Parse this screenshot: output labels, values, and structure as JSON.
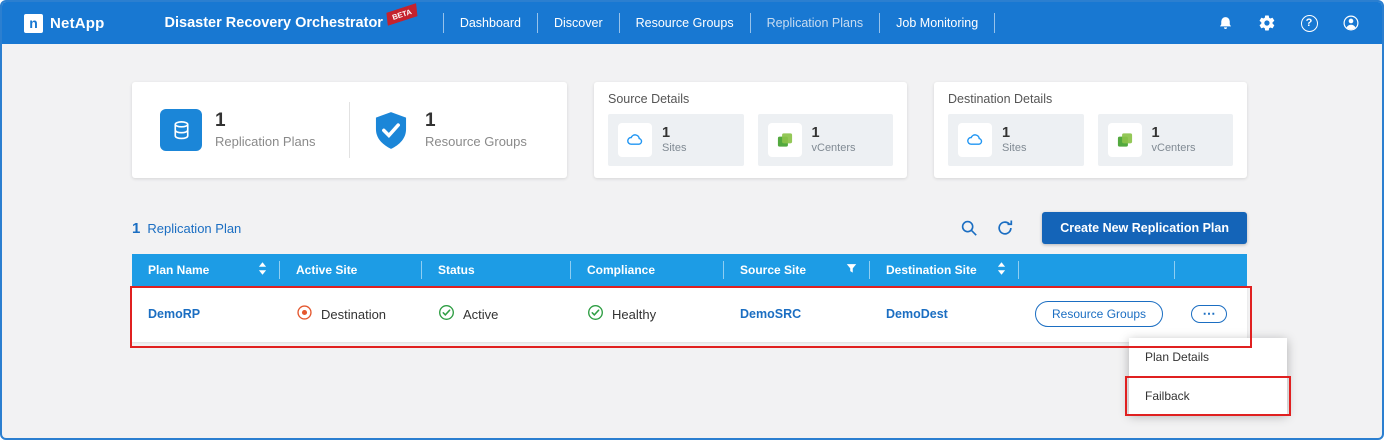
{
  "navbar": {
    "brand": "NetApp",
    "title": "Disaster Recovery Orchestrator",
    "beta": "BETA",
    "items": [
      {
        "label": "Dashboard"
      },
      {
        "label": "Discover"
      },
      {
        "label": "Resource Groups"
      },
      {
        "label": "Replication Plans"
      },
      {
        "label": "Job Monitoring"
      }
    ]
  },
  "icons": {
    "logo_letter": "n",
    "help_glyph": "?",
    "more_glyph": "⋯"
  },
  "summary": {
    "replication_plans": {
      "count": "1",
      "label": "Replication Plans"
    },
    "resource_groups": {
      "count": "1",
      "label": "Resource Groups"
    }
  },
  "source_details": {
    "title": "Source Details",
    "sites": {
      "count": "1",
      "label": "Sites"
    },
    "vcenters": {
      "count": "1",
      "label": "vCenters"
    }
  },
  "destination_details": {
    "title": "Destination Details",
    "sites": {
      "count": "1",
      "label": "Sites"
    },
    "vcenters": {
      "count": "1",
      "label": "vCenters"
    }
  },
  "plans_section": {
    "count": "1",
    "label": "Replication Plan",
    "create_button": "Create New Replication Plan"
  },
  "table": {
    "headers": [
      "Plan Name",
      "Active Site",
      "Status",
      "Compliance",
      "Source Site",
      "Destination Site"
    ],
    "row": {
      "plan_name": "DemoRP",
      "active_site": "Destination",
      "status": "Active",
      "compliance": "Healthy",
      "source_site": "DemoSRC",
      "destination_site": "DemoDest",
      "resource_groups": "Resource Groups"
    }
  },
  "context_menu": {
    "items": [
      "Plan Details",
      "Failback"
    ]
  }
}
